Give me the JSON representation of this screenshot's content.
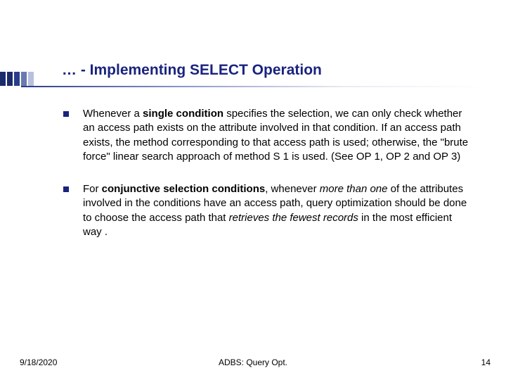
{
  "title": "… - Implementing SELECT Operation",
  "bullets": [
    {
      "pre": "Whenever a ",
      "bold1": "single condition",
      "mid": " specifies the selection, we can only check whether an access path exists on the attribute involved in that condition. If an access path exists, the method corresponding to that access path is used; otherwise, the \"brute force\" linear search approach of method S 1 is used. (See OP 1, OP 2 and OP 3)"
    },
    {
      "pre": "For ",
      "bold1": "conjunctive selection conditions",
      "mid": ", whenever ",
      "ital1": "more than one",
      "mid2": " of the attributes involved in the conditions have an access path, query optimization should be done to choose the access path that ",
      "ital2": "retrieves the fewest records",
      "post": " in the most efficient way ."
    }
  ],
  "footer": {
    "date": "9/18/2020",
    "center": "ADBS: Query Opt.",
    "page": "14"
  }
}
